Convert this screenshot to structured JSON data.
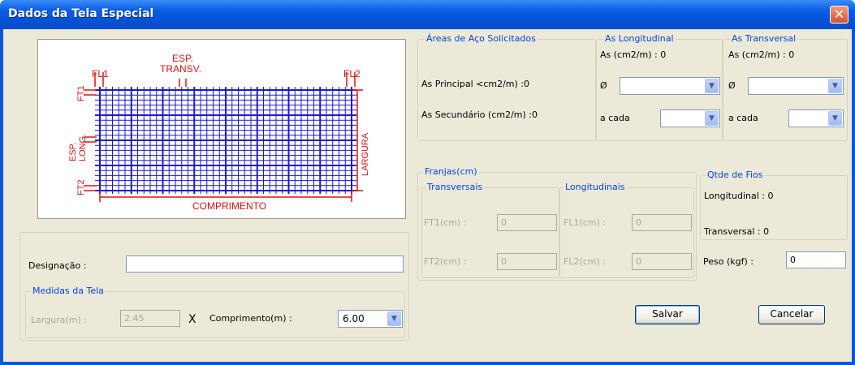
{
  "window": {
    "title": "Dados da Tela Especial",
    "close_icon": "close-icon"
  },
  "diagram": {
    "labels": {
      "esp_transv_1": "ESP.",
      "esp_transv_2": "TRANSV.",
      "fl1": "FL1",
      "fl2": "FL2",
      "ft1": "FT1",
      "ft2": "FT2",
      "esp_long_1": "ESP.",
      "esp_long_2": "LONG.",
      "largura": "LARGURA",
      "comprimento": "COMPRIMENTO"
    },
    "colors": {
      "grid": "#1a1ad0",
      "dimension": "#e01010"
    }
  },
  "areas": {
    "legend": "Áreas de Aço Solicitados",
    "principal_label": "As Principal <cm2/m) :0",
    "secundario_label": "As Secundário (cm2/m) :0"
  },
  "as_long": {
    "legend": "As Longitudinal",
    "as_label": "As (cm2/m) : 0",
    "phi_label": "Ø",
    "phi_value": "",
    "acada_label": "a cada",
    "acada_value": ""
  },
  "as_trans": {
    "legend": "As Transversal",
    "as_label": "As (cm2/m) : 0",
    "phi_label": "Ø",
    "phi_value": "",
    "acada_label": "a cada",
    "acada_value": ""
  },
  "franjas": {
    "legend": "Franjas(cm)",
    "transversais": {
      "legend": "Transversais",
      "ft1_label": "FT1(cm) :",
      "ft1_value": "0",
      "ft2_label": "FT2(cm) :",
      "ft2_value": "0"
    },
    "longitudinais": {
      "legend": "Longitudinais",
      "fl1_label": "FL1(cm) :",
      "fl1_value": "0",
      "fl2_label": "FL2(cm) :",
      "fl2_value": "0"
    }
  },
  "qtde": {
    "legend": "Qtde de Fios",
    "longitudinal_label": "Longitudinal : 0",
    "transversal_label": "Transversal : 0"
  },
  "peso": {
    "label": "Peso (kgf) :",
    "value": "0"
  },
  "designacao": {
    "label": "Designação :",
    "value": ""
  },
  "medidas": {
    "legend": "Medidas da Tela",
    "largura_label": "Largura(m) :",
    "largura_value": "2.45",
    "times": "X",
    "comprimento_label": "Comprimento(m) :",
    "comprimento_value": "6.00"
  },
  "buttons": {
    "salvar": "Salvar",
    "cancelar": "Cancelar"
  }
}
